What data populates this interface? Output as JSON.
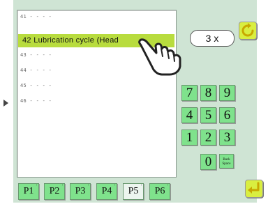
{
  "list": {
    "rows": [
      {
        "text": "41 - - - -"
      },
      {
        "text": "42 Lubrication cycle (Head"
      },
      {
        "text": "43 - - - -"
      },
      {
        "text": "44 - - - -"
      },
      {
        "text": "45 - - - -"
      },
      {
        "text": "46 - - - -"
      }
    ],
    "selected_index": 1
  },
  "counter": {
    "value": "3 x"
  },
  "keypad": {
    "keys": [
      "7",
      "8",
      "9",
      "4",
      "5",
      "6",
      "1",
      "2",
      "3",
      "0"
    ],
    "backspace_label_line1": "Back",
    "backspace_label_line2": "Space"
  },
  "tabs": [
    {
      "label": "P1"
    },
    {
      "label": "P2"
    },
    {
      "label": "P3"
    },
    {
      "label": "P4"
    },
    {
      "label": "P5"
    },
    {
      "label": "P6"
    }
  ],
  "active_tab": "P5",
  "colors": {
    "panel": "#cfe4d4",
    "key_green": "#7fe28c",
    "selection": "#b8dc3e",
    "action_yellow": "#d9ee40"
  }
}
